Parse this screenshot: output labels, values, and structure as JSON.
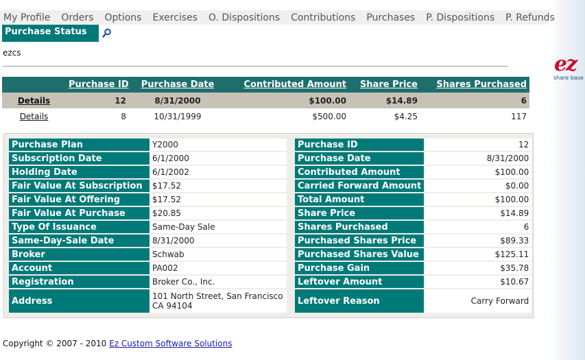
{
  "nav": [
    "My Profile",
    "Orders",
    "Options",
    "Exercises",
    "O. Dispositions",
    "Contributions",
    "Purchases",
    "P. Dispositions",
    "P. Refunds"
  ],
  "status_tab": "Purchase Status",
  "user": "ezcs",
  "logo": {
    "mark": "ez",
    "sub": "share base"
  },
  "list": {
    "headers": [
      "Purchase ID",
      "Purchase Date",
      "Contributed Amount",
      "Share Price",
      "Shares Purchased"
    ],
    "rows": [
      {
        "link": "Details",
        "id": "12",
        "date": "8/31/2000",
        "amount": "$100.00",
        "price": "$14.89",
        "shares": "6"
      },
      {
        "link": "Details",
        "id": "8",
        "date": "10/31/1999",
        "amount": "$500.00",
        "price": "$4.25",
        "shares": "117"
      }
    ]
  },
  "detail": {
    "left": [
      {
        "label": "Purchase Plan",
        "value": "Y2000"
      },
      {
        "label": "Subscription Date",
        "value": "6/1/2000"
      },
      {
        "label": "Holding Date",
        "value": "6/1/2002"
      },
      {
        "label": "Fair Value At Subscription",
        "value": "$17.52"
      },
      {
        "label": "Fair Value At Offering",
        "value": "$17.52"
      },
      {
        "label": "Fair Value At Purchase",
        "value": "$20.85"
      },
      {
        "label": "Type Of Issuance",
        "value": "Same-Day Sale"
      },
      {
        "label": "Same-Day-Sale Date",
        "value": "8/31/2000"
      },
      {
        "label": "Broker",
        "value": "Schwab"
      },
      {
        "label": "Account",
        "value": "PA002"
      },
      {
        "label": "Registration",
        "value": "Broker Co., Inc."
      },
      {
        "label": "Address",
        "value": "101 North Street, San Francisco",
        "value2": "CA 94104"
      }
    ],
    "right": [
      {
        "label": "Purchase ID",
        "value": "12"
      },
      {
        "label": "Purchase Date",
        "value": "8/31/2000"
      },
      {
        "label": "Contributed Amount",
        "value": "$100.00"
      },
      {
        "label": "Carried Forward Amount",
        "value": "$0.00"
      },
      {
        "label": "Total Amount",
        "value": "$100.00"
      },
      {
        "label": "Share Price",
        "value": "$14.89"
      },
      {
        "label": "Shares Purchased",
        "value": "6"
      },
      {
        "label": "Purchased Shares Price",
        "value": "$89.33"
      },
      {
        "label": "Purchased Shares Value",
        "value": "$125.11"
      },
      {
        "label": "Purchase Gain",
        "value": "$35.78"
      },
      {
        "label": "Leftover Amount",
        "value": "$10.67"
      },
      {
        "label": "Leftover Reason",
        "value": "Carry Forward"
      }
    ]
  },
  "footer": {
    "text": "Copyright © 2007 - 2010 ",
    "link": "Ez Custom Software Solutions"
  }
}
